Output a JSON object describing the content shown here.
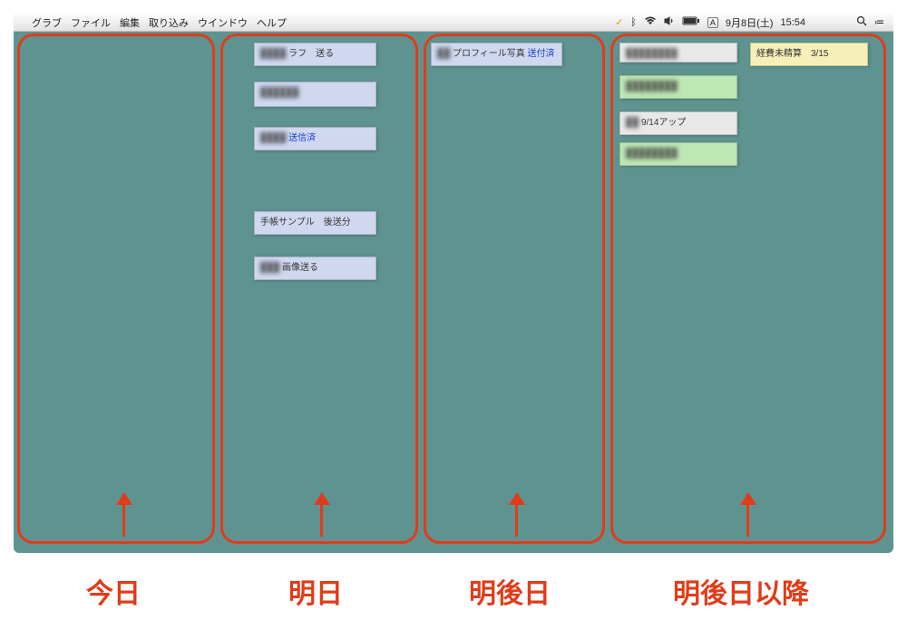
{
  "menubar": {
    "apple_label": "",
    "items": [
      "グラブ",
      "ファイル",
      "編集",
      "取り込み",
      "ウインドウ",
      "ヘルプ"
    ],
    "status": {
      "check": "✓",
      "bluetooth": "",
      "wifi": "",
      "volume": "",
      "battery": "",
      "ime": "A",
      "date": "9月8日(土)",
      "time": "15:54",
      "search": "",
      "list": "≔"
    }
  },
  "columns": {
    "c1": {
      "label": "今日"
    },
    "c2": {
      "label": "明日"
    },
    "c3": {
      "label": "明後日"
    },
    "c4": {
      "label": "明後日以降"
    }
  },
  "notes": {
    "tomorrow": [
      {
        "text": "ラフ　送る",
        "blurred_prefix": true
      },
      {
        "text": " ",
        "blurred_prefix": true
      },
      {
        "text": "送信済",
        "blurred_prefix": true,
        "link": true
      },
      {
        "text": "手帳サンプル　後送分"
      },
      {
        "text": "画像送る",
        "blurred_prefix": true
      }
    ],
    "day_after": [
      {
        "text": "プロフィール写真",
        "suffix": "送付済",
        "blurred_prefix": true,
        "link": true
      }
    ],
    "later_left": [
      {
        "text": " ",
        "color": "grey",
        "blurred_prefix": true
      },
      {
        "text": " ",
        "color": "green",
        "blurred_prefix": true
      },
      {
        "text": "9/14アップ",
        "color": "grey",
        "blurred_prefix": true
      },
      {
        "text": " ",
        "color": "green",
        "blurred_prefix": true
      }
    ],
    "later_right": [
      {
        "text": "経費未精算　3/15",
        "color": "yellow"
      }
    ]
  }
}
